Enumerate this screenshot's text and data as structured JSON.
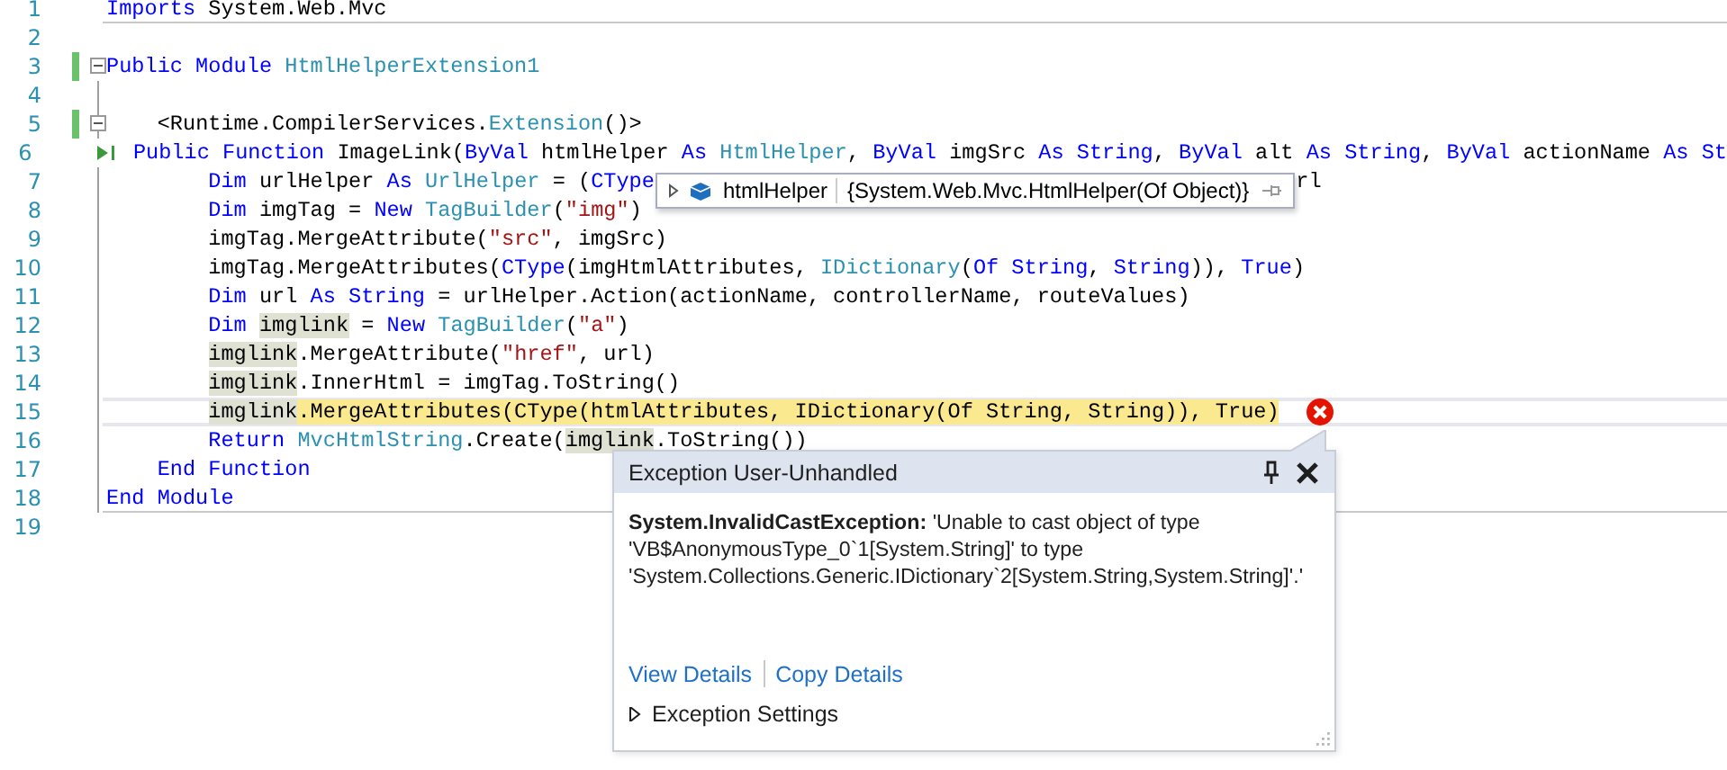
{
  "editor": {
    "lines": [
      {
        "number": "1",
        "separator": true,
        "tokens": [
          {
            "text": "Imports",
            "kind": "keyword"
          },
          {
            "text": " System.Web.Mvc",
            "kind": "plain"
          }
        ]
      },
      {
        "number": "2"
      },
      {
        "number": "3",
        "changed": true,
        "expanded": true,
        "tokens": [
          {
            "text": "Public Module ",
            "kind": "keyword"
          },
          {
            "text": "HtmlHelperExtension1",
            "kind": "type"
          }
        ]
      },
      {
        "number": "4"
      },
      {
        "number": "5",
        "changed": true,
        "expanded": true,
        "tokens": [
          {
            "text": "    <Runtime.CompilerServices.",
            "kind": "plain"
          },
          {
            "text": "Extension",
            "kind": "type"
          },
          {
            "text": "()>",
            "kind": "plain"
          }
        ]
      },
      {
        "number": "6",
        "run_to_click": true,
        "tokens": [
          {
            "text": "    Public Function",
            "kind": "keyword"
          },
          {
            "text": " ImageLink(",
            "kind": "plain"
          },
          {
            "text": "ByVal",
            "kind": "keyword"
          },
          {
            "text": " htmlHelper ",
            "kind": "plain"
          },
          {
            "text": "As ",
            "kind": "keyword"
          },
          {
            "text": "HtmlHelper",
            "kind": "type"
          },
          {
            "text": ", ",
            "kind": "plain"
          },
          {
            "text": "ByVal",
            "kind": "keyword"
          },
          {
            "text": " imgSrc ",
            "kind": "plain"
          },
          {
            "text": "As String",
            "kind": "keyword"
          },
          {
            "text": ", ",
            "kind": "plain"
          },
          {
            "text": "ByVal",
            "kind": "keyword"
          },
          {
            "text": " alt ",
            "kind": "plain"
          },
          {
            "text": "As String",
            "kind": "keyword"
          },
          {
            "text": ", ",
            "kind": "plain"
          },
          {
            "text": "ByVal",
            "kind": "keyword"
          },
          {
            "text": " actionName ",
            "kind": "plain"
          },
          {
            "text": "As St",
            "kind": "keyword"
          }
        ]
      },
      {
        "number": "7",
        "tokens": [
          {
            "text": "        Dim",
            "kind": "keyword"
          },
          {
            "text": " urlHelper ",
            "kind": "plain"
          },
          {
            "text": "As ",
            "kind": "keyword"
          },
          {
            "text": "UrlHelper",
            "kind": "type"
          },
          {
            "text": " = (",
            "kind": "plain"
          },
          {
            "text": "CType",
            "kind": "keyword"
          }
        ],
        "datatip": {
          "name": "htmlHelper",
          "value": "{System.Web.Mvc.HtmlHelper(Of Object)}"
        },
        "after": [
          {
            "text": "rl",
            "kind": "plain"
          }
        ]
      },
      {
        "number": "8",
        "tokens": [
          {
            "text": "        Dim",
            "kind": "keyword"
          },
          {
            "text": " imgTag = ",
            "kind": "plain"
          },
          {
            "text": "New ",
            "kind": "keyword"
          },
          {
            "text": "TagBuilder",
            "kind": "type"
          },
          {
            "text": "(",
            "kind": "plain"
          },
          {
            "text": "\"img\"",
            "kind": "string"
          },
          {
            "text": ")",
            "kind": "plain"
          }
        ]
      },
      {
        "number": "9",
        "tokens": [
          {
            "text": "        imgTag.MergeAttribute(",
            "kind": "plain"
          },
          {
            "text": "\"src\"",
            "kind": "string"
          },
          {
            "text": ", imgSrc)",
            "kind": "plain"
          }
        ]
      },
      {
        "number": "10",
        "tokens": [
          {
            "text": "        imgTag.MergeAttributes(",
            "kind": "plain"
          },
          {
            "text": "CType",
            "kind": "keyword"
          },
          {
            "text": "(imgHtmlAttributes, ",
            "kind": "plain"
          },
          {
            "text": "IDictionary",
            "kind": "type"
          },
          {
            "text": "(",
            "kind": "plain"
          },
          {
            "text": "Of String",
            "kind": "keyword"
          },
          {
            "text": ", ",
            "kind": "plain"
          },
          {
            "text": "String",
            "kind": "keyword"
          },
          {
            "text": ")), ",
            "kind": "plain"
          },
          {
            "text": "True",
            "kind": "keyword"
          },
          {
            "text": ")",
            "kind": "plain"
          }
        ]
      },
      {
        "number": "11",
        "tokens": [
          {
            "text": "        Dim",
            "kind": "keyword"
          },
          {
            "text": " url ",
            "kind": "plain"
          },
          {
            "text": "As String",
            "kind": "keyword"
          },
          {
            "text": " = urlHelper.Action(actionName, controllerName, routeValues)",
            "kind": "plain"
          }
        ]
      },
      {
        "number": "12",
        "tokens": [
          {
            "text": "        Dim ",
            "kind": "keyword"
          },
          {
            "text": "imglink",
            "kind": "reference"
          },
          {
            "text": " = ",
            "kind": "plain"
          },
          {
            "text": "New ",
            "kind": "keyword"
          },
          {
            "text": "TagBuilder",
            "kind": "type"
          },
          {
            "text": "(",
            "kind": "plain"
          },
          {
            "text": "\"a\"",
            "kind": "string"
          },
          {
            "text": ")",
            "kind": "plain"
          }
        ]
      },
      {
        "number": "13",
        "tokens": [
          {
            "text": "        imglink",
            "kind": "reference"
          },
          {
            "text": ".MergeAttribute(",
            "kind": "plain"
          },
          {
            "text": "\"href\"",
            "kind": "string"
          },
          {
            "text": ", url)",
            "kind": "plain"
          }
        ]
      },
      {
        "number": "14",
        "tokens": [
          {
            "text": "        imglink",
            "kind": "reference"
          },
          {
            "text": ".InnerHtml = imgTag.ToString()",
            "kind": "plain"
          }
        ]
      },
      {
        "number": "15",
        "current": true,
        "error": true,
        "tokens": [
          {
            "text": "        imglink",
            "kind": "reference"
          },
          {
            "text": ".MergeAttributes(CType(htmlAttributes, IDictionary(Of String, String)), True)",
            "kind": "statement"
          }
        ]
      },
      {
        "number": "16",
        "tokens": [
          {
            "text": "        Return ",
            "kind": "keyword"
          },
          {
            "text": "MvcHtmlString",
            "kind": "type"
          },
          {
            "text": ".Create(",
            "kind": "plain"
          },
          {
            "text": "imglink",
            "kind": "reference"
          },
          {
            "text": ".ToString())",
            "kind": "plain"
          }
        ]
      },
      {
        "number": "17",
        "tokens": [
          {
            "text": "    End Function",
            "kind": "keyword"
          }
        ]
      },
      {
        "number": "18",
        "separator": true,
        "tokens": [
          {
            "text": "End Module",
            "kind": "keyword"
          }
        ]
      },
      {
        "number": "19"
      }
    ]
  },
  "exception": {
    "title": "Exception User-Unhandled",
    "message": "**System.InvalidCastException:** 'Unable to cast object of type 'VB$AnonymousType_0`1[System.String]' to type 'System.Collections.Generic.IDictionary`2[System.String,System.String]'.'",
    "links": [
      "View Details",
      "Copy Details"
    ],
    "settings": {
      "label": "Exception Settings",
      "expanded": false
    }
  }
}
